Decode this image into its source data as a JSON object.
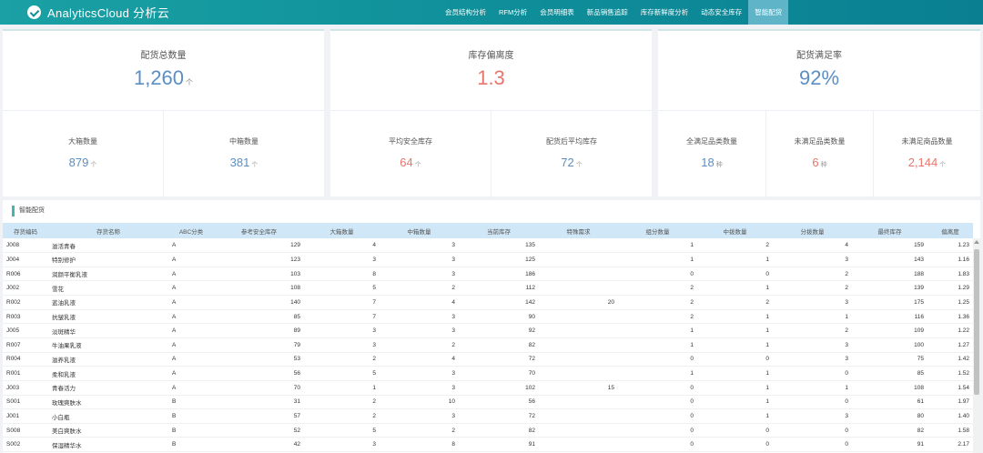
{
  "app": {
    "title": "AnalyticsCloud 分析云"
  },
  "nav": [
    {
      "label": "会员结构分析",
      "active": false
    },
    {
      "label": "RFM分析",
      "active": false
    },
    {
      "label": "会员明细表",
      "active": false
    },
    {
      "label": "新品销售追踪",
      "active": false
    },
    {
      "label": "库存新鲜度分析",
      "active": false
    },
    {
      "label": "动态安全库存",
      "active": false
    },
    {
      "label": "智能配货",
      "active": true
    }
  ],
  "kpi": {
    "total": {
      "label": "配货总数量",
      "value": "1,260",
      "unit": "个"
    },
    "deviation": {
      "label": "库存偏离度",
      "value": "1.3"
    },
    "satisfaction": {
      "label": "配货满足率",
      "value": "92%"
    },
    "big_box": {
      "label": "大箱数量",
      "value": "879",
      "unit": "个"
    },
    "mid_box": {
      "label": "中箱数量",
      "value": "381",
      "unit": "个"
    },
    "avg_safety": {
      "label": "平均安全库存",
      "value": "64",
      "unit": "个"
    },
    "avg_after": {
      "label": "配货后平均库存",
      "value": "72",
      "unit": "个"
    },
    "full_cat": {
      "label": "全满足品类数量",
      "value": "18",
      "unit": "种"
    },
    "unmet_cat": {
      "label": "未满足品类数量",
      "value": "6",
      "unit": "种"
    },
    "unmet_goods": {
      "label": "未满足商品数量",
      "value": "2,144",
      "unit": "个"
    }
  },
  "colors": {
    "accent_blue": "#5b8ec4",
    "accent_red": "#e8756b",
    "header": "#0f8f9a"
  },
  "section": {
    "title": "智能配货"
  },
  "table": {
    "headers": [
      "存货编码",
      "存货名称",
      "ABC分类",
      "参考安全库存",
      "大箱数量",
      "中箱数量",
      "当前库存",
      "特殊需求",
      "组分数量",
      "中拨数量",
      "分拨数量",
      "最终库存",
      "偏离度"
    ],
    "rows": [
      [
        "J008",
        "滋活青春",
        "A",
        "129",
        "4",
        "3",
        "135",
        "",
        "1",
        "2",
        "4",
        "159",
        "1.23"
      ],
      [
        "J004",
        "特别修护",
        "A",
        "123",
        "3",
        "3",
        "125",
        "",
        "1",
        "1",
        "3",
        "143",
        "1.16"
      ],
      [
        "R006",
        "润颜平衡乳液",
        "A",
        "103",
        "8",
        "3",
        "186",
        "",
        "0",
        "0",
        "2",
        "188",
        "1.83"
      ],
      [
        "J002",
        "雪花",
        "A",
        "108",
        "5",
        "2",
        "112",
        "",
        "2",
        "1",
        "2",
        "139",
        "1.29"
      ],
      [
        "R002",
        "蓝油乳液",
        "A",
        "140",
        "7",
        "4",
        "142",
        "20",
        "2",
        "2",
        "3",
        "175",
        "1.25"
      ],
      [
        "R003",
        "抗皱乳液",
        "A",
        "85",
        "7",
        "3",
        "90",
        "",
        "2",
        "1",
        "1",
        "116",
        "1.36"
      ],
      [
        "J005",
        "淡斑精华",
        "A",
        "89",
        "3",
        "3",
        "92",
        "",
        "1",
        "1",
        "2",
        "109",
        "1.22"
      ],
      [
        "R007",
        "牛油果乳液",
        "A",
        "79",
        "3",
        "2",
        "82",
        "",
        "1",
        "1",
        "3",
        "100",
        "1.27"
      ],
      [
        "R004",
        "滋养乳液",
        "A",
        "53",
        "2",
        "4",
        "72",
        "",
        "0",
        "0",
        "3",
        "75",
        "1.42"
      ],
      [
        "R001",
        "柔和乳液",
        "A",
        "56",
        "5",
        "3",
        "70",
        "",
        "1",
        "1",
        "0",
        "85",
        "1.52"
      ],
      [
        "J003",
        "青春活力",
        "A",
        "70",
        "1",
        "3",
        "102",
        "15",
        "0",
        "1",
        "1",
        "108",
        "1.54"
      ],
      [
        "S001",
        "玫瑰爽肤水",
        "B",
        "31",
        "2",
        "10",
        "56",
        "",
        "0",
        "1",
        "0",
        "61",
        "1.97"
      ],
      [
        "J001",
        "小白瓶",
        "B",
        "57",
        "2",
        "3",
        "72",
        "",
        "0",
        "1",
        "3",
        "80",
        "1.40"
      ],
      [
        "S008",
        "美白爽肤水",
        "B",
        "52",
        "5",
        "2",
        "82",
        "",
        "0",
        "0",
        "0",
        "82",
        "1.58"
      ],
      [
        "S002",
        "保湿精华水",
        "B",
        "42",
        "3",
        "8",
        "91",
        "",
        "0",
        "0",
        "0",
        "91",
        "2.17"
      ]
    ]
  }
}
